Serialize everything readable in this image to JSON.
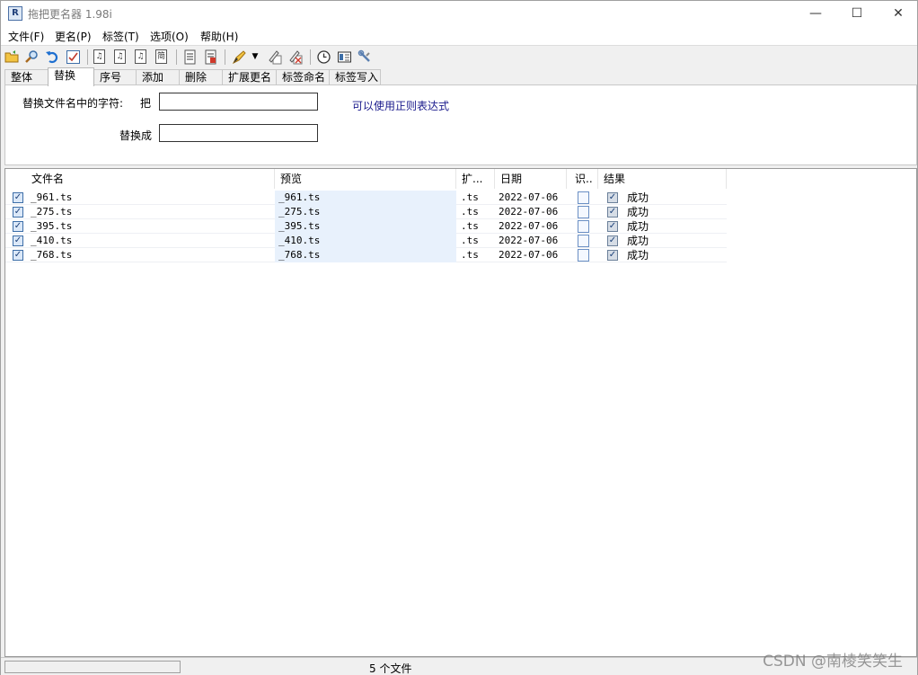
{
  "window": {
    "title": "拖把更名器 1.98i",
    "icon": "R",
    "controls": {
      "minimize": "—",
      "maximize": "☐",
      "close": "✕"
    }
  },
  "menu": [
    "文件(F)",
    "更名(P)",
    "标签(T)",
    "选项(O)",
    "帮助(H)"
  ],
  "toolbar": {
    "icons": [
      "open-folder-icon",
      "search-icon",
      "undo-icon",
      "check-icon",
      "music-tag-icon-1",
      "music-tag-icon-2",
      "music-tag-icon-3",
      "abbrev-icon",
      "document-icon",
      "report-icon",
      "paint-icon",
      "dropdown-arrow-icon",
      "edit-tag-icon",
      "clear-tag-icon",
      "clock-icon",
      "window-icon",
      "tools-icon"
    ],
    "abbrev_label": "简"
  },
  "tabs": [
    "整体",
    "替换",
    "序号",
    "添加",
    "删除",
    "扩展更名",
    "标签命名",
    "标签写入"
  ],
  "active_tab": "替换",
  "replace_panel": {
    "find_label": "替换文件名中的字符:",
    "find_prefix": "把",
    "find_value": "",
    "replace_label": "替换成",
    "replace_value": "",
    "hint": "可以使用正则表达式"
  },
  "list": {
    "columns": [
      "文件名",
      "预览",
      "扩...",
      "日期",
      "识..",
      "结果"
    ],
    "rows": [
      {
        "name": "_961.ts",
        "preview": "_961.ts",
        "ext": ".ts",
        "date": "2022-07-06",
        "result": "成功",
        "checked": true
      },
      {
        "name": "_275.ts",
        "preview": "_275.ts",
        "ext": ".ts",
        "date": "2022-07-06",
        "result": "成功",
        "checked": true
      },
      {
        "name": "_395.ts",
        "preview": "_395.ts",
        "ext": ".ts",
        "date": "2022-07-06",
        "result": "成功",
        "checked": true
      },
      {
        "name": "_410.ts",
        "preview": "_410.ts",
        "ext": ".ts",
        "date": "2022-07-06",
        "result": "成功",
        "checked": true
      },
      {
        "name": "_768.ts",
        "preview": "_768.ts",
        "ext": ".ts",
        "date": "2022-07-06",
        "result": "成功",
        "checked": true
      }
    ]
  },
  "status": {
    "file_count": "5 个文件",
    "progress": 0
  },
  "watermark": "CSDN @南棱笑笑生",
  "colors": {
    "hint": "#1a1a8c",
    "preview_bg": "#e8f1fc",
    "checkbox": "#3d6ea8"
  }
}
